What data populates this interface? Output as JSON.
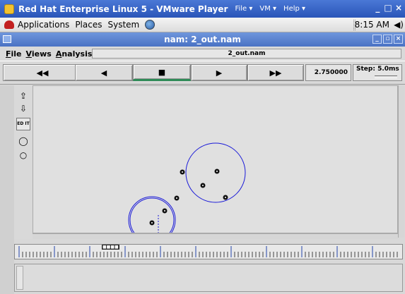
{
  "vmware": {
    "title": "Red Hat Enterprise Linux 5 - VMware Player",
    "menus": [
      "File ▾",
      "VM ▾",
      "Help ▾"
    ],
    "minimize": "_",
    "close": "□ ×"
  },
  "gnome_panel": {
    "menus": [
      "Applications",
      "Places",
      "System"
    ],
    "clock": "8:15 AM",
    "volume_glyph": "◀)"
  },
  "nam_window": {
    "title": "nam: 2_out.nam",
    "menus": {
      "file": {
        "u": "F",
        "rest": "ile"
      },
      "views": {
        "u": "V",
        "rest": "iews"
      },
      "analysis": {
        "u": "A",
        "rest": "nalysis"
      }
    },
    "filename": "2_out.nam"
  },
  "controls": {
    "fast_rewind": "◀◀",
    "rewind": "◀",
    "stop": "■",
    "play": "▶",
    "fast_forward": "▶▶",
    "time": "2.750000",
    "step_label": "Step: 5.0ms"
  },
  "tools": {
    "zoom_in": "⇪",
    "zoom_out": "⇩",
    "edit_label": "ED IT"
  },
  "timeline": {
    "marker": "■■■■"
  },
  "topology": {
    "nodes": [
      {
        "id": "n1"
      },
      {
        "id": "n2"
      },
      {
        "id": "n3"
      },
      {
        "id": "n4"
      },
      {
        "id": "n5"
      },
      {
        "id": "n6"
      },
      {
        "id": "n7"
      }
    ]
  },
  "colors": {
    "circle": "#1a1ad8",
    "progress": "#2e8b57"
  }
}
